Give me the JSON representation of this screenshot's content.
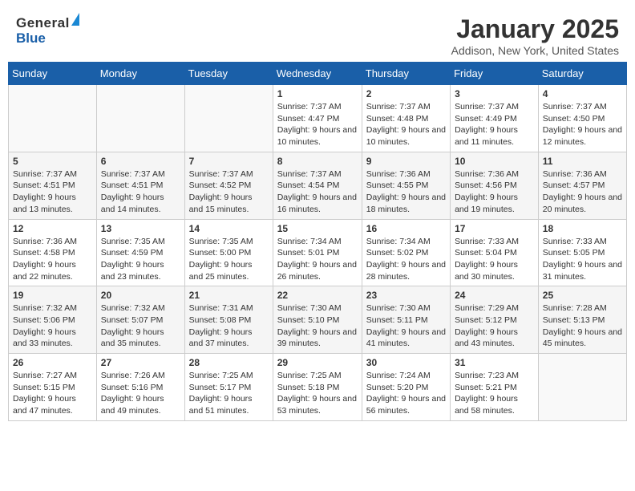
{
  "header": {
    "logo_general": "General",
    "logo_blue": "Blue",
    "month": "January 2025",
    "location": "Addison, New York, United States"
  },
  "weekdays": [
    "Sunday",
    "Monday",
    "Tuesday",
    "Wednesday",
    "Thursday",
    "Friday",
    "Saturday"
  ],
  "weeks": [
    [
      {
        "day": "",
        "sunrise": "",
        "sunset": "",
        "daylight": ""
      },
      {
        "day": "",
        "sunrise": "",
        "sunset": "",
        "daylight": ""
      },
      {
        "day": "",
        "sunrise": "",
        "sunset": "",
        "daylight": ""
      },
      {
        "day": "1",
        "sunrise": "Sunrise: 7:37 AM",
        "sunset": "Sunset: 4:47 PM",
        "daylight": "Daylight: 9 hours and 10 minutes."
      },
      {
        "day": "2",
        "sunrise": "Sunrise: 7:37 AM",
        "sunset": "Sunset: 4:48 PM",
        "daylight": "Daylight: 9 hours and 10 minutes."
      },
      {
        "day": "3",
        "sunrise": "Sunrise: 7:37 AM",
        "sunset": "Sunset: 4:49 PM",
        "daylight": "Daylight: 9 hours and 11 minutes."
      },
      {
        "day": "4",
        "sunrise": "Sunrise: 7:37 AM",
        "sunset": "Sunset: 4:50 PM",
        "daylight": "Daylight: 9 hours and 12 minutes."
      }
    ],
    [
      {
        "day": "5",
        "sunrise": "Sunrise: 7:37 AM",
        "sunset": "Sunset: 4:51 PM",
        "daylight": "Daylight: 9 hours and 13 minutes."
      },
      {
        "day": "6",
        "sunrise": "Sunrise: 7:37 AM",
        "sunset": "Sunset: 4:51 PM",
        "daylight": "Daylight: 9 hours and 14 minutes."
      },
      {
        "day": "7",
        "sunrise": "Sunrise: 7:37 AM",
        "sunset": "Sunset: 4:52 PM",
        "daylight": "Daylight: 9 hours and 15 minutes."
      },
      {
        "day": "8",
        "sunrise": "Sunrise: 7:37 AM",
        "sunset": "Sunset: 4:54 PM",
        "daylight": "Daylight: 9 hours and 16 minutes."
      },
      {
        "day": "9",
        "sunrise": "Sunrise: 7:36 AM",
        "sunset": "Sunset: 4:55 PM",
        "daylight": "Daylight: 9 hours and 18 minutes."
      },
      {
        "day": "10",
        "sunrise": "Sunrise: 7:36 AM",
        "sunset": "Sunset: 4:56 PM",
        "daylight": "Daylight: 9 hours and 19 minutes."
      },
      {
        "day": "11",
        "sunrise": "Sunrise: 7:36 AM",
        "sunset": "Sunset: 4:57 PM",
        "daylight": "Daylight: 9 hours and 20 minutes."
      }
    ],
    [
      {
        "day": "12",
        "sunrise": "Sunrise: 7:36 AM",
        "sunset": "Sunset: 4:58 PM",
        "daylight": "Daylight: 9 hours and 22 minutes."
      },
      {
        "day": "13",
        "sunrise": "Sunrise: 7:35 AM",
        "sunset": "Sunset: 4:59 PM",
        "daylight": "Daylight: 9 hours and 23 minutes."
      },
      {
        "day": "14",
        "sunrise": "Sunrise: 7:35 AM",
        "sunset": "Sunset: 5:00 PM",
        "daylight": "Daylight: 9 hours and 25 minutes."
      },
      {
        "day": "15",
        "sunrise": "Sunrise: 7:34 AM",
        "sunset": "Sunset: 5:01 PM",
        "daylight": "Daylight: 9 hours and 26 minutes."
      },
      {
        "day": "16",
        "sunrise": "Sunrise: 7:34 AM",
        "sunset": "Sunset: 5:02 PM",
        "daylight": "Daylight: 9 hours and 28 minutes."
      },
      {
        "day": "17",
        "sunrise": "Sunrise: 7:33 AM",
        "sunset": "Sunset: 5:04 PM",
        "daylight": "Daylight: 9 hours and 30 minutes."
      },
      {
        "day": "18",
        "sunrise": "Sunrise: 7:33 AM",
        "sunset": "Sunset: 5:05 PM",
        "daylight": "Daylight: 9 hours and 31 minutes."
      }
    ],
    [
      {
        "day": "19",
        "sunrise": "Sunrise: 7:32 AM",
        "sunset": "Sunset: 5:06 PM",
        "daylight": "Daylight: 9 hours and 33 minutes."
      },
      {
        "day": "20",
        "sunrise": "Sunrise: 7:32 AM",
        "sunset": "Sunset: 5:07 PM",
        "daylight": "Daylight: 9 hours and 35 minutes."
      },
      {
        "day": "21",
        "sunrise": "Sunrise: 7:31 AM",
        "sunset": "Sunset: 5:08 PM",
        "daylight": "Daylight: 9 hours and 37 minutes."
      },
      {
        "day": "22",
        "sunrise": "Sunrise: 7:30 AM",
        "sunset": "Sunset: 5:10 PM",
        "daylight": "Daylight: 9 hours and 39 minutes."
      },
      {
        "day": "23",
        "sunrise": "Sunrise: 7:30 AM",
        "sunset": "Sunset: 5:11 PM",
        "daylight": "Daylight: 9 hours and 41 minutes."
      },
      {
        "day": "24",
        "sunrise": "Sunrise: 7:29 AM",
        "sunset": "Sunset: 5:12 PM",
        "daylight": "Daylight: 9 hours and 43 minutes."
      },
      {
        "day": "25",
        "sunrise": "Sunrise: 7:28 AM",
        "sunset": "Sunset: 5:13 PM",
        "daylight": "Daylight: 9 hours and 45 minutes."
      }
    ],
    [
      {
        "day": "26",
        "sunrise": "Sunrise: 7:27 AM",
        "sunset": "Sunset: 5:15 PM",
        "daylight": "Daylight: 9 hours and 47 minutes."
      },
      {
        "day": "27",
        "sunrise": "Sunrise: 7:26 AM",
        "sunset": "Sunset: 5:16 PM",
        "daylight": "Daylight: 9 hours and 49 minutes."
      },
      {
        "day": "28",
        "sunrise": "Sunrise: 7:25 AM",
        "sunset": "Sunset: 5:17 PM",
        "daylight": "Daylight: 9 hours and 51 minutes."
      },
      {
        "day": "29",
        "sunrise": "Sunrise: 7:25 AM",
        "sunset": "Sunset: 5:18 PM",
        "daylight": "Daylight: 9 hours and 53 minutes."
      },
      {
        "day": "30",
        "sunrise": "Sunrise: 7:24 AM",
        "sunset": "Sunset: 5:20 PM",
        "daylight": "Daylight: 9 hours and 56 minutes."
      },
      {
        "day": "31",
        "sunrise": "Sunrise: 7:23 AM",
        "sunset": "Sunset: 5:21 PM",
        "daylight": "Daylight: 9 hours and 58 minutes."
      },
      {
        "day": "",
        "sunrise": "",
        "sunset": "",
        "daylight": ""
      }
    ]
  ]
}
